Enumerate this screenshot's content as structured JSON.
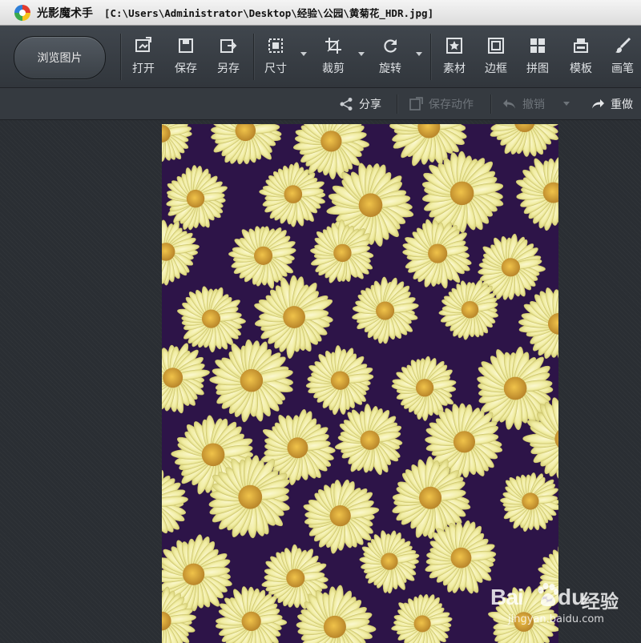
{
  "window": {
    "app_name": "光影魔术手",
    "file_path": "[C:\\Users\\Administrator\\Desktop\\经验\\公园\\黄菊花_HDR.jpg]"
  },
  "toolbar": {
    "browse_label": "浏览图片",
    "buttons": [
      {
        "label": "打开",
        "icon": "open-icon"
      },
      {
        "label": "保存",
        "icon": "save-icon"
      },
      {
        "label": "另存",
        "icon": "save-as-icon"
      },
      {
        "label": "尺寸",
        "icon": "resize-icon"
      },
      {
        "label": "裁剪",
        "icon": "crop-icon"
      },
      {
        "label": "旋转",
        "icon": "rotate-icon"
      },
      {
        "label": "素材",
        "icon": "material-icon"
      },
      {
        "label": "边框",
        "icon": "border-icon"
      },
      {
        "label": "拼图",
        "icon": "collage-icon"
      },
      {
        "label": "模板",
        "icon": "template-icon"
      },
      {
        "label": "画笔",
        "icon": "brush-icon"
      }
    ]
  },
  "actionbar": {
    "share_label": "分享",
    "save_action_label": "保存动作",
    "undo_label": "撤销",
    "redo_label": "重做"
  },
  "watermark": {
    "brand": "Bai",
    "brand2": "du",
    "product": "经验",
    "url": "jingyan.baidu.com"
  },
  "colors": {
    "toolbar_bg": "#3b4046",
    "canvas_bg": "#2a2e33",
    "petal": "#f3f0b4",
    "center": "#e0a92b",
    "photo_shadow": "#2d1448"
  }
}
